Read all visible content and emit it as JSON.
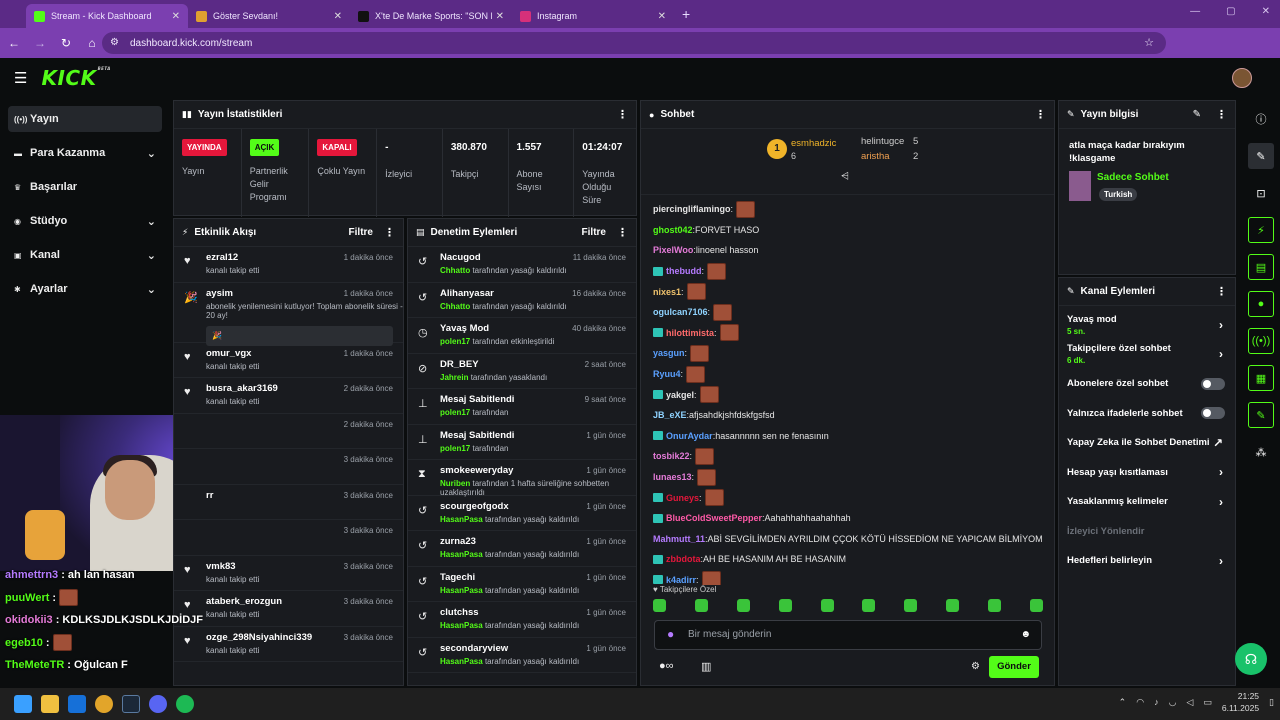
{
  "browser": {
    "tabs": [
      {
        "title": "Stream - Kick Dashboard",
        "color": "#53fc18",
        "active": true
      },
      {
        "title": "Göster Sevdanı!",
        "color": "#e0a030",
        "active": false
      },
      {
        "title": "X'te De Marke Sports: \"SON DA",
        "color": "#111111",
        "active": false
      },
      {
        "title": "Instagram",
        "color": "#d6307a",
        "active": false
      }
    ],
    "url": "dashboard.kick.com/stream"
  },
  "app": {
    "logo": "KICK",
    "beta": "BETA"
  },
  "sidebar": {
    "items": [
      {
        "label": "Yayın",
        "icon": "stream-icon",
        "glyph": "((•))",
        "chevron": false,
        "active": true
      },
      {
        "label": "Para Kazanma",
        "icon": "money-icon",
        "glyph": "▬",
        "chevron": true
      },
      {
        "label": "Başarılar",
        "icon": "trophy-icon",
        "glyph": "♛",
        "chevron": false
      },
      {
        "label": "Stüdyo",
        "icon": "studio-icon",
        "glyph": "◉",
        "chevron": true
      },
      {
        "label": "Kanal",
        "icon": "channel-icon",
        "glyph": "▣",
        "chevron": true
      },
      {
        "label": "Ayarlar",
        "icon": "settings-icon",
        "glyph": "✱",
        "chevron": true
      }
    ]
  },
  "stats_panel": {
    "title": "Yayın İstatistikleri",
    "items": [
      {
        "badge": "YAYINDA",
        "badge_bg": "#e5173b",
        "badge_fg": "#ffffff",
        "label": "Yayın"
      },
      {
        "badge": "AÇIK",
        "badge_bg": "#53fc18",
        "badge_fg": "#0b0d0e",
        "label": "Partnerlik Gelir Programı"
      },
      {
        "badge": "KAPALI",
        "badge_bg": "#e5173b",
        "badge_fg": "#ffffff",
        "label": "Çoklu Yayın"
      },
      {
        "value": "-",
        "label": "İzleyici"
      },
      {
        "value": "380.870",
        "label": "Takipçi"
      },
      {
        "value": "1.557",
        "label": "Abone Sayısı"
      },
      {
        "value": "01:24:07",
        "label": "Yayında Olduğu Süre"
      }
    ]
  },
  "activity": {
    "title": "Etkinlik Akışı",
    "filter": "Filtre",
    "items": [
      {
        "name": "ezral12",
        "text": "kanalı takip etti",
        "time": "1 dakika önce",
        "icon": "♥"
      },
      {
        "name": "aysim",
        "text": "abonelik yenilemesini kutluyor! Toplam abonelik süresi - 20 ay!",
        "time": "1 dakika önce",
        "icon": "🎉",
        "gift": "🎉"
      },
      {
        "name": "omur_vgx",
        "text": "kanalı takip etti",
        "time": "1 dakika önce",
        "icon": "♥"
      },
      {
        "name": "busra_akar3169",
        "text": "kanalı takip etti",
        "time": "2 dakika önce",
        "icon": "♥"
      },
      {
        "name": "",
        "text": "",
        "time": "2 dakika önce",
        "icon": ""
      },
      {
        "name": "",
        "text": "",
        "time": "3 dakika önce",
        "icon": ""
      },
      {
        "name": "rr",
        "text": "",
        "time": "3 dakika önce",
        "icon": ""
      },
      {
        "name": "",
        "text": "",
        "time": "3 dakika önce",
        "icon": ""
      },
      {
        "name": "vmk83",
        "text": "kanalı takip etti",
        "time": "3 dakika önce",
        "icon": "♥"
      },
      {
        "name": "ataberk_erozgun",
        "text": "kanalı takip etti",
        "time": "3 dakika önce",
        "icon": "♥"
      },
      {
        "name": "ozge_298Nsiyahinci339",
        "text": "kanalı takip etti",
        "time": "3 dakika önce",
        "icon": "♥"
      }
    ]
  },
  "moderation": {
    "title": "Denetim Eylemleri",
    "filter": "Filtre",
    "items": [
      {
        "name": "Nacugod",
        "by": "Chhatto",
        "text": "tarafından yasağı kaldırıldı",
        "time": "11 dakika önce",
        "icon": "↺"
      },
      {
        "name": "Alihanyasar",
        "by": "Chhatto",
        "text": "tarafından yasağı kaldırıldı",
        "time": "16 dakika önce",
        "icon": "↺"
      },
      {
        "name": "Yavaş Mod",
        "by": "polen17",
        "text": "tarafından etkinleştirildi",
        "time": "40 dakika önce",
        "icon": "◷"
      },
      {
        "name": "DR_BEY",
        "by": "Jahrein",
        "text": "tarafından yasaklandı",
        "time": "2 saat önce",
        "icon": "⊘"
      },
      {
        "name": "Mesaj Sabitlendi",
        "by": "polen17",
        "text": "tarafından",
        "time": "9 saat önce",
        "icon": "⊥"
      },
      {
        "name": "Mesaj Sabitlendi",
        "by": "polen17",
        "text": "tarafından",
        "time": "1 gün önce",
        "icon": "⊥"
      },
      {
        "name": "smokeeweryday",
        "by": "Nuriben",
        "text": "tarafından 1 hafta süreliğine sohbetten uzaklaştırıldı",
        "time": "1 gün önce",
        "icon": "⧗"
      },
      {
        "name": "scourgeofgodx",
        "by": "HasanPasa",
        "text": "tarafından yasağı kaldırıldı",
        "time": "1 gün önce",
        "icon": "↺"
      },
      {
        "name": "zurna23",
        "by": "HasanPasa",
        "text": "tarafından yasağı kaldırıldı",
        "time": "1 gün önce",
        "icon": "↺"
      },
      {
        "name": "Tagechi",
        "by": "HasanPasa",
        "text": "tarafından yasağı kaldırıldı",
        "time": "1 gün önce",
        "icon": "↺"
      },
      {
        "name": "clutchss",
        "by": "HasanPasa",
        "text": "tarafından yasağı kaldırıldı",
        "time": "1 gün önce",
        "icon": "↺"
      },
      {
        "name": "secondaryview",
        "by": "HasanPasa",
        "text": "tarafından yasağı kaldırıldı",
        "time": "1 gün önce",
        "icon": "↺"
      }
    ]
  },
  "chat": {
    "title": "Sohbet",
    "leaders": [
      {
        "rank": "1",
        "name": "esmhadzic",
        "count": "6"
      },
      {
        "name": "helintugce",
        "count": "5"
      },
      {
        "name": "aristha",
        "count": "2"
      }
    ],
    "messages": [
      {
        "user": "piercingliflamingo",
        "color": "#e6e6e6",
        "text": "",
        "emote": true
      },
      {
        "user": "ghost042",
        "color": "#53fc18",
        "text": "FORVET HASO"
      },
      {
        "user": "PixelWoo",
        "color": "#e47bd8",
        "text": "linoenel hasson"
      },
      {
        "user": "thebudd",
        "color": "#b57bff",
        "text": "",
        "emote": true,
        "badge": true
      },
      {
        "user": "nixes1",
        "color": "#f0c36d",
        "text": "",
        "emote": true
      },
      {
        "user": "ogulcan7106",
        "color": "#8fd3ff",
        "text": "",
        "emote": true
      },
      {
        "user": "hilottimista",
        "color": "#ff6b6b",
        "text": "",
        "emote": true,
        "badge": true
      },
      {
        "user": "yasgun",
        "color": "#5aa0ff",
        "text": "",
        "emote": true
      },
      {
        "user": "Ryuu4",
        "color": "#5aa0ff",
        "text": "",
        "emote": true
      },
      {
        "user": "yakgel",
        "color": "#e6e6e6",
        "text": "",
        "emote": true,
        "badge": true
      },
      {
        "user": "JB_eXE",
        "color": "#8fd3ff",
        "text": "afjsahdkjshfdskfgsfsd"
      },
      {
        "user": "OnurAydar",
        "color": "#5aa0ff",
        "text": "hasannnnn sen ne fenasının",
        "badge": true
      },
      {
        "user": "tosbik22",
        "color": "#e47bd8",
        "text": "",
        "emote": true
      },
      {
        "user": "lunaes13",
        "color": "#e47bd8",
        "text": "",
        "emote": true
      },
      {
        "user": "Guneys",
        "color": "#e5173b",
        "text": "",
        "emote": true,
        "badge": true
      },
      {
        "user": "BlueColdSweetPepper",
        "color": "#ff5aa8",
        "text": "Aahahhahhaahahhah",
        "badge": true
      },
      {
        "user": "Mahmutt_11",
        "color": "#b57bff",
        "text": "ABİ SEVGİLİMDEN AYRILDIM ÇÇOK KÖTÜ HİSSEDİOM NE YAPICAM BİLMİYOM"
      },
      {
        "user": "zbbdota",
        "color": "#e5173b",
        "text": "AH BE HASANIM AH BE HASANIM",
        "badge": true
      },
      {
        "user": "k4adirr",
        "color": "#5aa0ff",
        "text": "",
        "emote": true,
        "badge": true
      }
    ],
    "followers_only": "Takipçilere Özel",
    "input_placeholder": "Bir mesaj gönderin",
    "send_label": "Gönder"
  },
  "stream_info": {
    "title": "Yayın bilgisi",
    "stream_title": "atla maça kadar bırakıyım !klasgame",
    "category": "Sadece Sohbet",
    "language": "Turkish"
  },
  "channel_actions": {
    "title": "Kanal Eylemleri",
    "items": [
      {
        "label": "Yavaş mod",
        "sub": "5 sn.",
        "type": "chevron"
      },
      {
        "label": "Takipçilere özel sohbet",
        "sub": "6 dk.",
        "type": "chevron"
      },
      {
        "label": "Abonelere özel sohbet",
        "type": "toggle"
      },
      {
        "label": "Yalnızca ifadelerle sohbet",
        "type": "toggle"
      },
      {
        "label": "Yapay Zeka ile Sohbet Denetimi",
        "type": "external"
      },
      {
        "label": "Hesap yaşı kısıtlaması",
        "type": "chevron"
      },
      {
        "label": "Yasaklanmış kelimeler",
        "type": "chevron"
      },
      {
        "label": "İzleyici Yönlendir",
        "type": "disabled"
      },
      {
        "label": "Hedefleri belirleyin",
        "type": "chevron"
      }
    ]
  },
  "overlay_chat": [
    {
      "user": "ahmettrn3",
      "color": "#b57bff",
      "text": ": ah lan hasan"
    },
    {
      "user": "puuWert",
      "color": "#53fc18",
      "text": ":",
      "emote": true
    },
    {
      "user": "okidokii3",
      "color": "#e47bd8",
      "text": ": KDLKSJDLKJSDLKJDİDJF"
    },
    {
      "user": "egeb10",
      "color": "#53fc18",
      "text": ":",
      "emote": true
    },
    {
      "user": "TheMeteTR",
      "color": "#53fc18",
      "text": ": Oğulcan F"
    }
  ],
  "taskbar": {
    "time": "21:25",
    "date": "6.11.2025"
  }
}
